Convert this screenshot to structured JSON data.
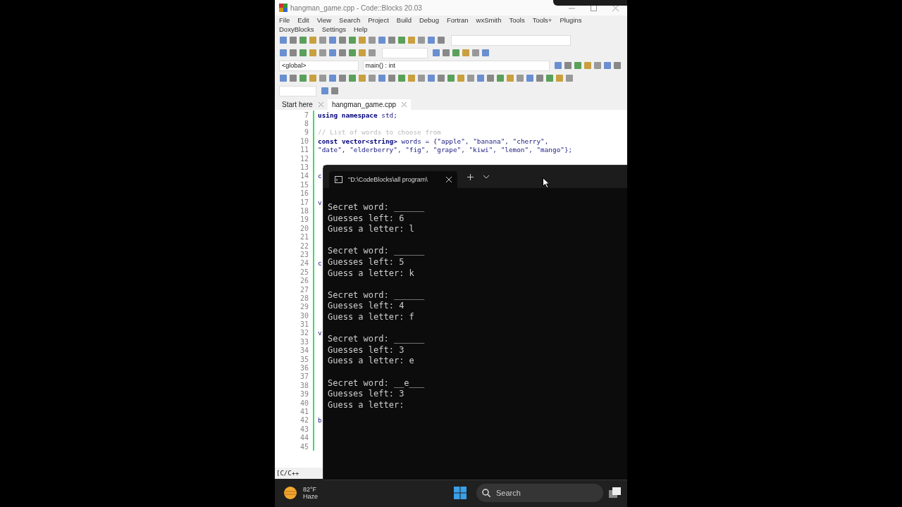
{
  "window": {
    "title": "hangman_game.cpp - Code::Blocks 20.03"
  },
  "menu": {
    "items": [
      "File",
      "Edit",
      "View",
      "Search",
      "Project",
      "Build",
      "Debug",
      "Fortran",
      "wxSmith",
      "Tools",
      "Tools+",
      "Plugins",
      "DoxyBlocks",
      "Settings",
      "Help"
    ]
  },
  "scope_bar": {
    "scope": "<global>",
    "function": "main() : int"
  },
  "tabs": [
    {
      "label": "Start here",
      "selected": false
    },
    {
      "label": "hangman_game.cpp",
      "selected": true
    }
  ],
  "editor": {
    "lines": [
      {
        "number": "7",
        "code": "**using namespace** std;"
      },
      {
        "number": "8"
      },
      {
        "number": "9",
        "code": "// List of words to choose from",
        "kind": "comment"
      },
      {
        "number": "10",
        "code": "**const** **vector<string>** words = {\"apple\", \"banana\", \"cherry\","
      },
      {
        "number": "11",
        "code": "\"date\", \"elderberry\", \"fig\", \"grape\", \"kiwi\", \"lemon\", \"mango\"};"
      },
      {
        "number": "12"
      },
      {
        "number": "13"
      },
      {
        "number": "14",
        "code": "c"
      },
      {
        "number": "15"
      },
      {
        "number": "16"
      },
      {
        "number": "17",
        "code": "v"
      },
      {
        "number": "18"
      },
      {
        "number": "19"
      },
      {
        "number": "20"
      },
      {
        "number": "21"
      },
      {
        "number": "22"
      },
      {
        "number": "23"
      },
      {
        "number": "24",
        "code": "c"
      },
      {
        "number": "25"
      },
      {
        "number": "26"
      },
      {
        "number": "27"
      },
      {
        "number": "28"
      },
      {
        "number": "29"
      },
      {
        "number": "30"
      },
      {
        "number": "31"
      },
      {
        "number": "32",
        "code": "v"
      },
      {
        "number": "33"
      },
      {
        "number": "34"
      },
      {
        "number": "35"
      },
      {
        "number": "36"
      },
      {
        "number": "37"
      },
      {
        "number": "38"
      },
      {
        "number": "39"
      },
      {
        "number": "40"
      },
      {
        "number": "41"
      },
      {
        "number": "42",
        "code": "b"
      },
      {
        "number": "43"
      },
      {
        "number": "44"
      },
      {
        "number": "45"
      }
    ]
  },
  "status_bar": {
    "language": "[C/C++"
  },
  "console": {
    "tab_title": "\"D:\\CodeBlocks\\all program\\",
    "rounds": [
      {
        "secret": "Secret word: ______",
        "guesses": "Guesses left: 6",
        "guess": "Guess a letter: l"
      },
      {
        "secret": "Secret word: ______",
        "guesses": "Guesses left: 5",
        "guess": "Guess a letter: k"
      },
      {
        "secret": "Secret word: ______",
        "guesses": "Guesses left: 4",
        "guess": "Guess a letter: f"
      },
      {
        "secret": "Secret word: ______",
        "guesses": "Guesses left: 3",
        "guess": "Guess a letter: e"
      },
      {
        "secret": "Secret word: __e___",
        "guesses": "Guesses left: 3",
        "guess": "Guess a letter:"
      }
    ]
  },
  "taskbar": {
    "temperature": "82°F",
    "weather": "Haze",
    "search_placeholder": "Search"
  }
}
